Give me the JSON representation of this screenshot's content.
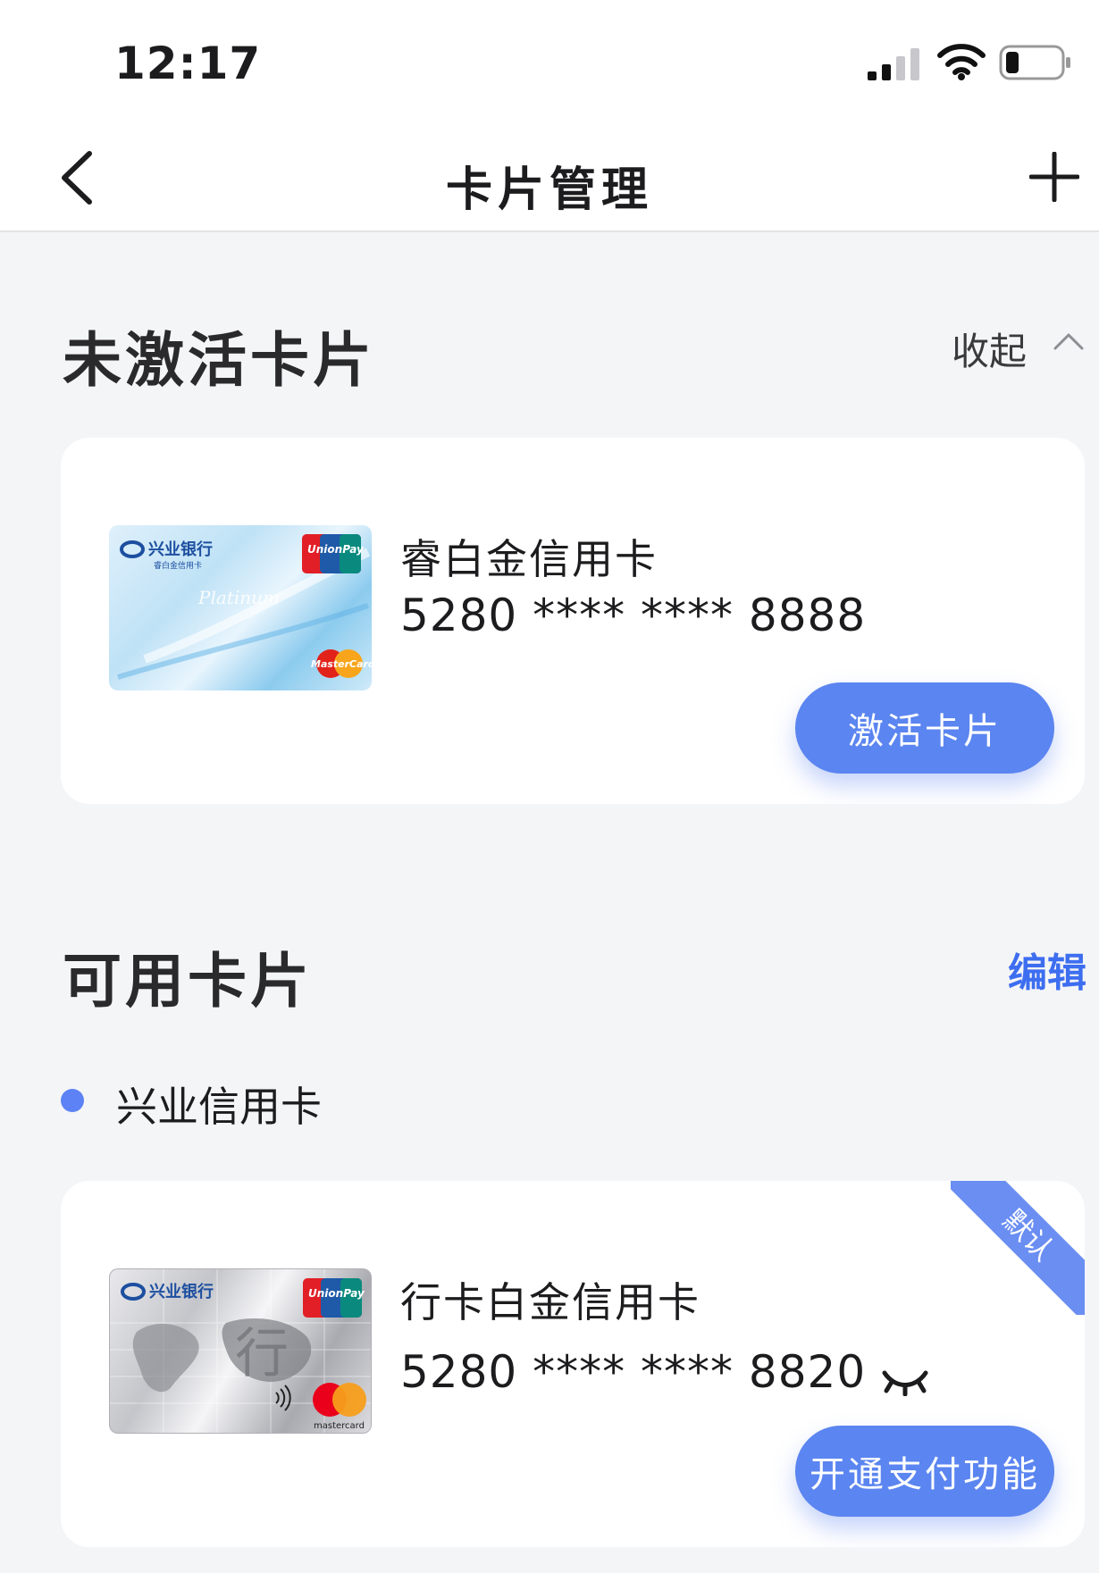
{
  "status_bar": {
    "time": "12:17"
  },
  "nav": {
    "title": "卡片管理"
  },
  "inactive_section": {
    "title": "未激活卡片",
    "collapse_label": "收起",
    "card": {
      "name": "睿白金信用卡",
      "number": "5280 **** **** 8888",
      "action_label": "激活卡片",
      "card_image": {
        "bank_name": "兴业银行",
        "product": "睿白金信用卡",
        "script_text": "Platinum",
        "network": "MasterCard",
        "union": "UnionPay 银联"
      }
    }
  },
  "available_section": {
    "title": "可用卡片",
    "edit_label": "编辑",
    "group_label": "兴业信用卡",
    "card": {
      "name": "行卡白金信用卡",
      "number": "5280 **** **** 8820",
      "badge": "默认",
      "action_label": "开通支付功能",
      "card_image": {
        "bank_name": "兴业银行",
        "network": "mastercard",
        "union": "UnionPay 银联"
      }
    }
  },
  "colors": {
    "accent": "#5b85f0",
    "link": "#3d6ef0",
    "background": "#f4f5f7"
  }
}
